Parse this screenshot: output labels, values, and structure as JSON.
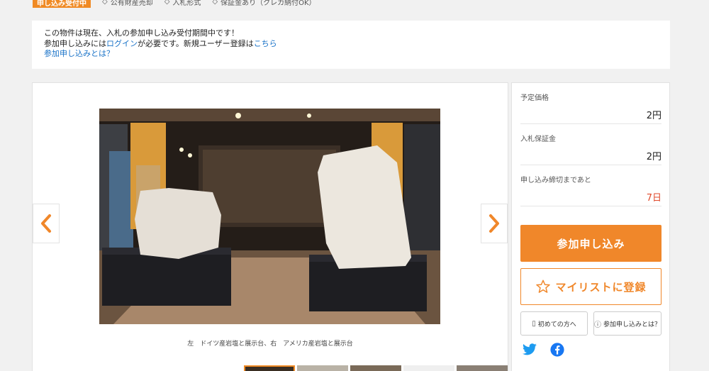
{
  "status_badge": "申し込み受付中",
  "tags": [
    {
      "icon": "diamond-icon",
      "label": "公有財産売却"
    },
    {
      "icon": "diamond-icon",
      "label": "入札形式"
    },
    {
      "icon": "diamond-icon",
      "label": "保証金あり（クレカ納付OK）"
    }
  ],
  "notice": {
    "line1": "この物件は現在、入札の参加申し込み受付期間中です！",
    "line2_prefix": "参加申し込みには",
    "line2_login": "ログイン",
    "line2_middle": "が必要です。新規ユーザー登録は",
    "line2_here": "こちら",
    "line3_link": "参加申し込みとは？"
  },
  "gallery": {
    "caption": "左　ドイツ産岩塩と展示台、右　アメリカ産岩塩と展示台",
    "prev_icon": "chevron-left-icon",
    "next_icon": "chevron-right-icon"
  },
  "info": {
    "planned_price_label": "予定価格",
    "planned_price_value": "2円",
    "deposit_label": "入札保証金",
    "deposit_value": "2円",
    "deadline_label": "申し込み締切まであと",
    "deadline_value": "7日",
    "join_button": "参加申し込み",
    "mylist_button": "マイリストに登録",
    "first_time_button": "初めての方へ",
    "about_button": "参加申し込みとは？"
  },
  "colors": {
    "accent": "#f0872a",
    "link": "#1a73c8",
    "deadline": "#e04a2c",
    "twitter": "#1d9bf0",
    "facebook": "#1877f2"
  }
}
